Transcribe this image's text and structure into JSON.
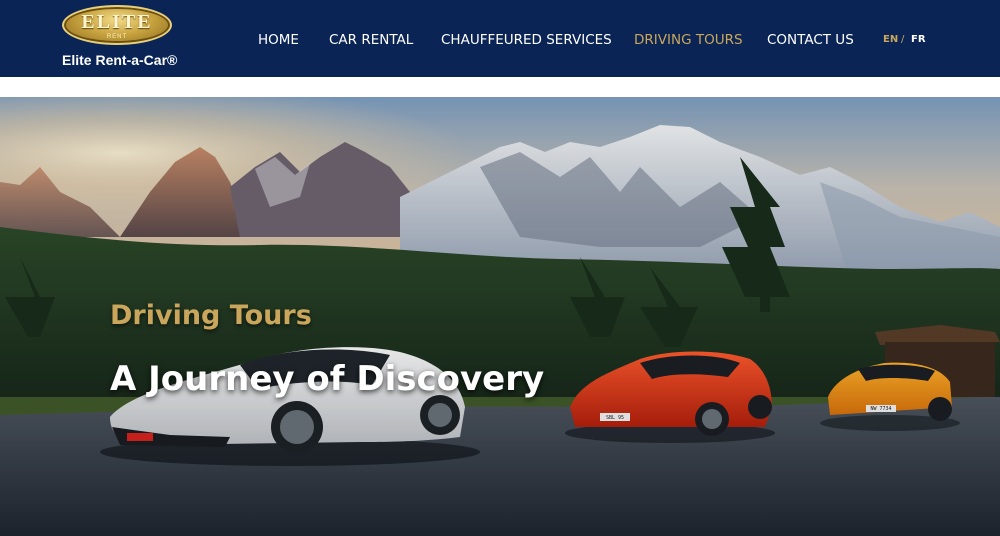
{
  "logo": {
    "wordmark": "ELITE",
    "submark": "RENT"
  },
  "brand": {
    "name": "Elite Rent-a-Car®"
  },
  "nav": {
    "items": [
      {
        "label": "HOME"
      },
      {
        "label": "CAR RENTAL"
      },
      {
        "label": "CHAUFFEURED SERVICES"
      },
      {
        "label": "DRIVING TOURS",
        "active": true
      },
      {
        "label": "CONTACT US"
      }
    ]
  },
  "language": {
    "en": "EN",
    "separator": "/",
    "fr": "FR",
    "active": "EN"
  },
  "hero": {
    "eyebrow": "Driving Tours",
    "title": "A Journey of Discovery",
    "plates": [
      "",
      "SBL 95",
      "NW 7734"
    ]
  },
  "colors": {
    "header_bg": "#0a2456",
    "accent_gold": "#c9a75a",
    "nav_text": "#ffffff"
  }
}
